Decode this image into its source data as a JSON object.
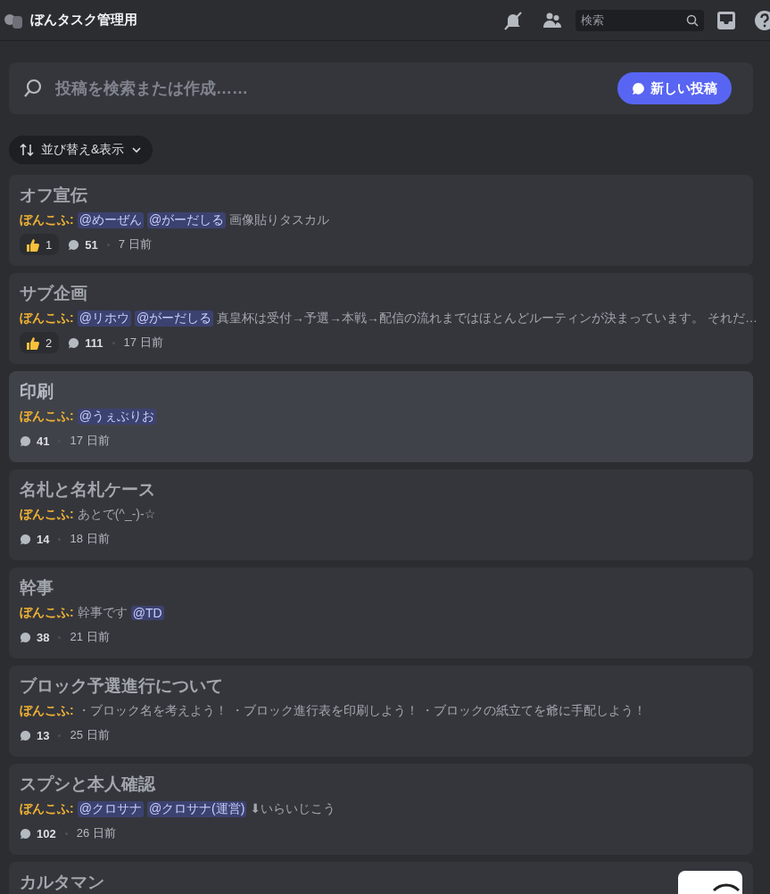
{
  "header": {
    "channel_name": "ぼんタスク管理用",
    "search_placeholder": "検索"
  },
  "composer": {
    "placeholder": "投稿を検索または作成……",
    "new_post_button": "新しい投稿"
  },
  "sort_button": "並び替え&表示",
  "posts": [
    {
      "title": "オフ宣伝",
      "author": "ぼんこふ:",
      "preview": [
        {
          "kind": "mention",
          "text": "@めーぜん"
        },
        {
          "kind": "mention",
          "text": "@がーだしる"
        },
        {
          "kind": "text",
          "text": "画像貼りタスカル"
        }
      ],
      "reaction_count": "1",
      "comments": "51",
      "age": "7 日前",
      "selected": false
    },
    {
      "title": "サブ企画",
      "author": "ぼんこふ:",
      "preview": [
        {
          "kind": "mention",
          "text": "@リホウ"
        },
        {
          "kind": "mention",
          "text": "@がーだしる"
        },
        {
          "kind": "text",
          "text": "真皇杯は受付→予選→本戦→配信の流れまではほとんどルーティンが決まっています。 それだ…"
        }
      ],
      "reaction_count": "2",
      "comments": "111",
      "age": "17 日前",
      "selected": false
    },
    {
      "title": "印刷",
      "author": "ぼんこふ:",
      "preview": [
        {
          "kind": "mention",
          "text": "@うぇぶりお"
        }
      ],
      "comments": "41",
      "age": "17 日前",
      "selected": true
    },
    {
      "title": "名札と名札ケース",
      "author": "ぼんこふ:",
      "preview": [
        {
          "kind": "text",
          "text": "あとで(^_-)-☆"
        }
      ],
      "comments": "14",
      "age": "18 日前",
      "selected": false
    },
    {
      "title": "幹事",
      "author": "ぼんこふ:",
      "preview": [
        {
          "kind": "text",
          "text": "幹事です"
        },
        {
          "kind": "mention",
          "text": "@TD"
        }
      ],
      "comments": "38",
      "age": "21 日前",
      "selected": false
    },
    {
      "title": "ブロック予選進行について",
      "author": "ぼんこふ:",
      "preview": [
        {
          "kind": "text",
          "text": "・ブロック名を考えよう！ ・ブロック進行表を印刷しよう！ ・ブロックの紙立てを爺に手配しよう！"
        }
      ],
      "comments": "13",
      "age": "25 日前",
      "selected": false
    },
    {
      "title": "スプシと本人確認",
      "author": "ぼんこふ:",
      "preview": [
        {
          "kind": "mention",
          "text": "@クロサナ"
        },
        {
          "kind": "mention",
          "text": "@クロサナ(運営)"
        },
        {
          "kind": "text",
          "text": "⬇いらいじこう"
        }
      ],
      "comments": "102",
      "age": "26 日前",
      "selected": false
    },
    {
      "title": "カルタマン",
      "selected": false
    }
  ]
}
